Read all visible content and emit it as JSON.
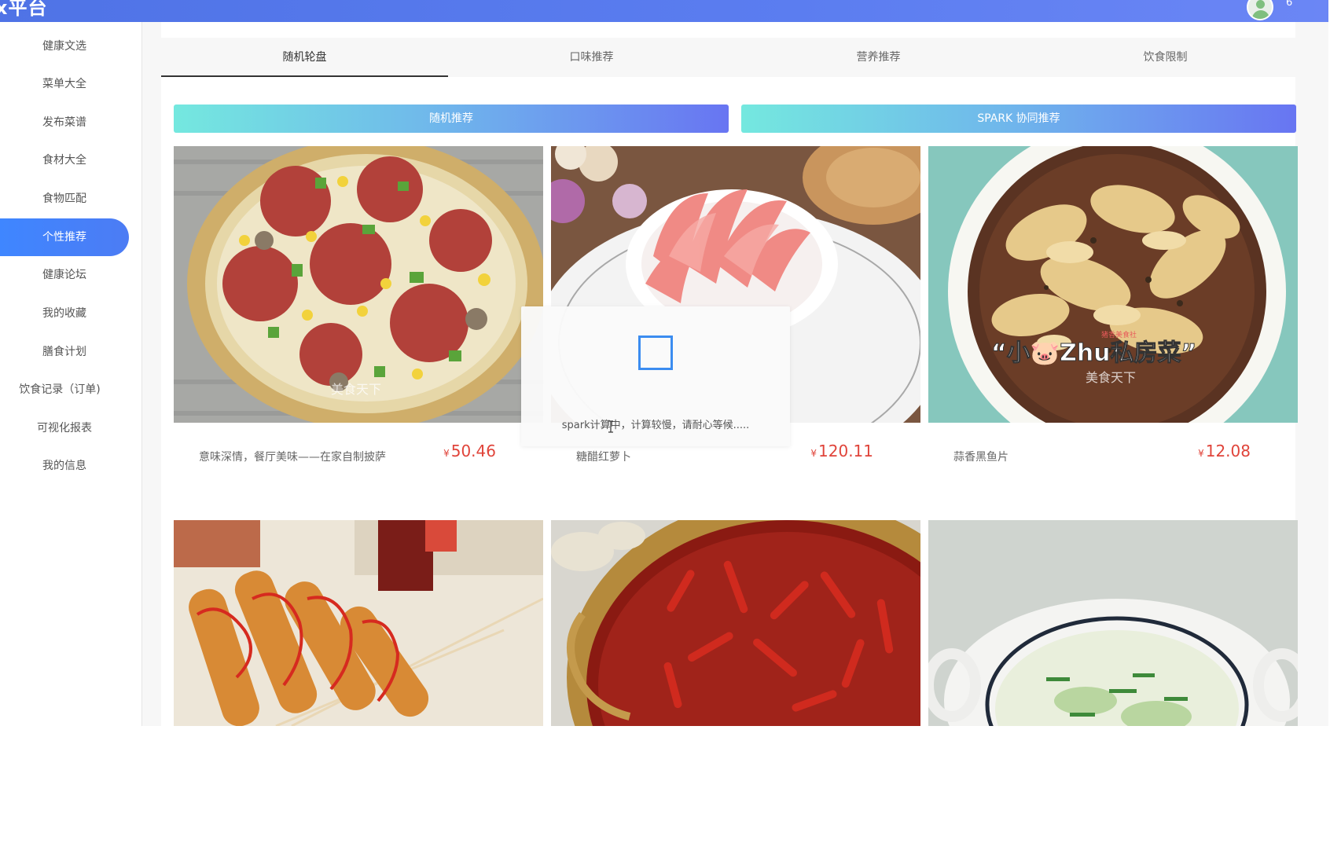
{
  "header": {
    "brand": "x平台",
    "user_name": "6"
  },
  "sidebar": {
    "items": [
      {
        "label": "健康文选"
      },
      {
        "label": "菜单大全"
      },
      {
        "label": "发布菜谱"
      },
      {
        "label": "食材大全"
      },
      {
        "label": "食物匹配"
      },
      {
        "label": "个性推荐",
        "active": true
      },
      {
        "label": "健康论坛"
      },
      {
        "label": "我的收藏"
      },
      {
        "label": "膳食计划"
      },
      {
        "label": "饮食记录（订单)"
      },
      {
        "label": "可视化报表"
      },
      {
        "label": "我的信息"
      }
    ]
  },
  "tabs": [
    {
      "label": "随机轮盘",
      "active": true
    },
    {
      "label": "口味推荐"
    },
    {
      "label": "营养推荐"
    },
    {
      "label": "饮食限制"
    }
  ],
  "buttons": {
    "random": "随机推荐",
    "spark": "SPARK 协同推荐"
  },
  "currency_symbol": "¥",
  "cards": [
    {
      "name": "意味深情，餐厅美味——在家自制披萨",
      "price": "50.46",
      "image": "pizza",
      "watermark": "美食天下"
    },
    {
      "name": "糖醋红萝卜",
      "price": "120.11",
      "image": "pickled-radish",
      "watermark": ""
    },
    {
      "name": "蒜香黑鱼片",
      "price": "12.08",
      "image": "garlic-fish",
      "watermark": "美食天下",
      "overlay_text": "“小🐷Zhu私房菜”",
      "overlay_small": "猪香美食社"
    },
    {
      "name": "",
      "price": "",
      "image": "corn-dogs"
    },
    {
      "name": "",
      "price": "",
      "image": "chili-pot"
    },
    {
      "name": "",
      "price": "",
      "image": "winter-melon-soup"
    }
  ],
  "loading": {
    "message": "spark计算中，计算较慢，请耐心等候....."
  },
  "colors": {
    "header": "#5b7df0",
    "active_nav": "#3f86ff",
    "price": "#e0443a",
    "spinner": "#3b8cf0"
  }
}
